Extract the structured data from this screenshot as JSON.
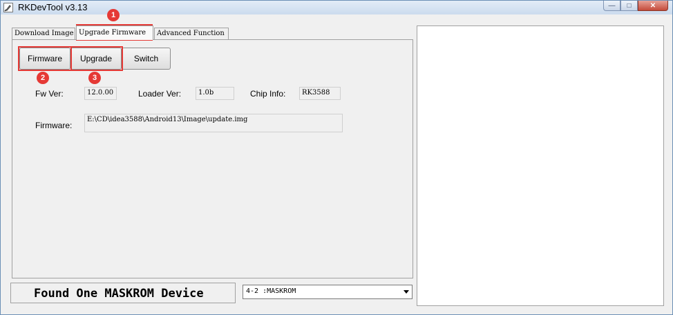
{
  "window": {
    "title": "RKDevTool v3.13",
    "controls": {
      "minimize": "—",
      "maximize": "□",
      "close": "✕"
    }
  },
  "tabs": [
    {
      "label": "Download Image",
      "active": false
    },
    {
      "label": "Upgrade Firmware",
      "active": true
    },
    {
      "label": "Advanced Function",
      "active": false
    }
  ],
  "buttons": {
    "firmware": "Firmware",
    "upgrade": "Upgrade",
    "switch": "Switch"
  },
  "fields": {
    "fw_ver_label": "Fw Ver:",
    "fw_ver_value": "12.0.00",
    "loader_ver_label": "Loader Ver:",
    "loader_ver_value": "1.0b",
    "chip_info_label": "Chip Info:",
    "chip_info_value": "RK3588",
    "firmware_label": "Firmware:",
    "firmware_path": "E:\\CD\\idea3588\\Android13\\Image\\update.img"
  },
  "status": {
    "message": "Found One MASKROM Device",
    "device_selected": "4-2 :MASKROM"
  },
  "annotations": {
    "markers": [
      "1",
      "2",
      "3"
    ],
    "color": "#e53935"
  }
}
